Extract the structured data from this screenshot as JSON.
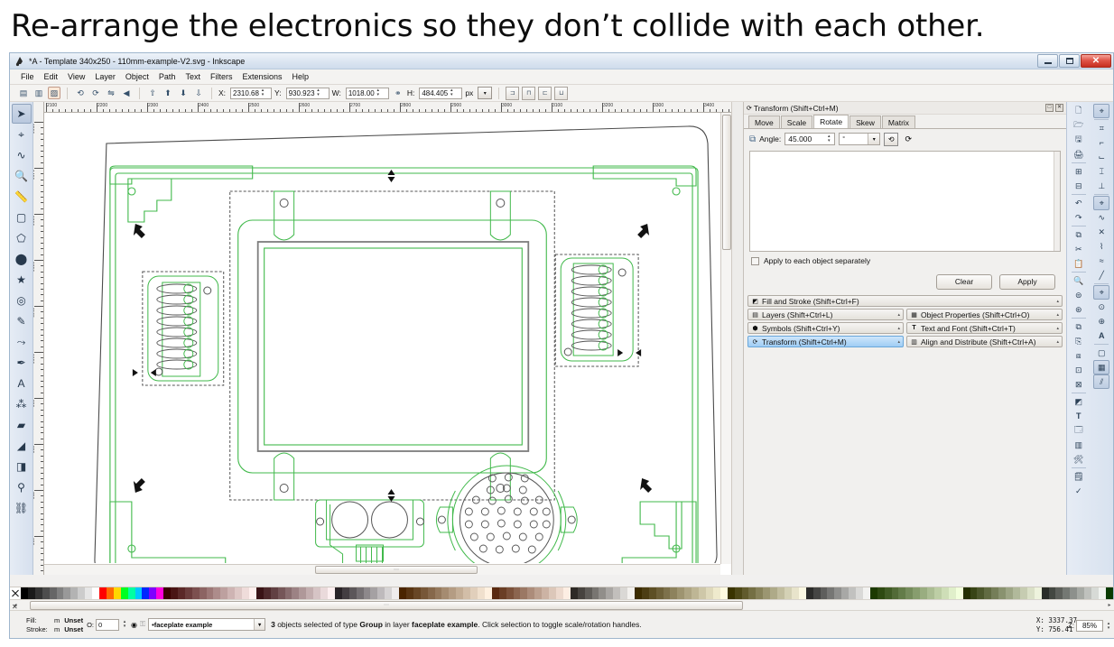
{
  "slide": {
    "heading": "Re-arrange the electronics so they don’t collide with each other."
  },
  "window": {
    "title": "*A - Template 340x250 - 110mm-example-V2.svg - Inkscape",
    "minimize_label": "–",
    "maximize_label": "❐",
    "close_label": "✕"
  },
  "menu": {
    "items": [
      "File",
      "Edit",
      "View",
      "Layer",
      "Object",
      "Path",
      "Text",
      "Filters",
      "Extensions",
      "Help"
    ]
  },
  "toolbar": {
    "icons": [
      "select-all-icon",
      "select-all-layers-icon",
      "deselect-icon",
      "rotate-ccw-icon",
      "rotate-cw-icon",
      "flip-horizontal-icon",
      "flip-vertical-icon",
      "raise-to-top-icon",
      "raise-icon",
      "lower-icon",
      "lower-to-bottom-icon"
    ],
    "x_label": "X:",
    "x_value": "2310.68",
    "y_label": "Y:",
    "y_value": "930.923",
    "w_label": "W:",
    "w_value": "1018.00",
    "lock_label": "⚭",
    "h_label": "H:",
    "h_value": "484.405",
    "units": "px",
    "units_caret": "▾",
    "toggles": [
      "affect-stroke-width",
      "affect-rounded-corners",
      "affect-gradients",
      "affect-patterns"
    ]
  },
  "tools": {
    "items": [
      {
        "name": "selector-tool",
        "glyph": "➤",
        "active": true
      },
      {
        "name": "node-tool",
        "glyph": "✒",
        "active": false
      },
      {
        "name": "tweak-tool",
        "glyph": "∿",
        "active": false
      },
      {
        "name": "zoom-tool",
        "glyph": "⌕",
        "active": false
      },
      {
        "name": "measure-tool",
        "glyph": "╱",
        "active": false
      },
      {
        "name": "rectangle-tool",
        "glyph": "□",
        "active": false
      },
      {
        "name": "3dbox-tool",
        "glyph": "⬡",
        "active": false
      },
      {
        "name": "ellipse-tool",
        "glyph": "●",
        "active": false
      },
      {
        "name": "star-tool",
        "glyph": "★",
        "active": false
      },
      {
        "name": "spiral-tool",
        "glyph": "◎",
        "active": false
      },
      {
        "name": "pencil-tool",
        "glyph": "✎",
        "active": false
      },
      {
        "name": "bezier-tool",
        "glyph": "⤳",
        "active": false
      },
      {
        "name": "calligraphy-tool",
        "glyph": "✒",
        "active": false
      },
      {
        "name": "text-tool",
        "glyph": "A",
        "active": false
      },
      {
        "name": "spray-tool",
        "glyph": "⁂",
        "active": false
      },
      {
        "name": "eraser-tool",
        "glyph": "▰",
        "active": false
      },
      {
        "name": "bucket-fill-tool",
        "glyph": "◢",
        "active": false
      },
      {
        "name": "gradient-tool",
        "glyph": "◧",
        "active": false
      },
      {
        "name": "dropper-tool",
        "glyph": "✒",
        "active": false
      },
      {
        "name": "connector-tool",
        "glyph": "⛓",
        "active": false
      }
    ]
  },
  "rulers": {
    "h_labels": [
      "2100",
      "2200",
      "2300",
      "2400",
      "2500",
      "2600",
      "2700",
      "2800",
      "2900",
      "3000",
      "3100",
      "3200",
      "3300",
      "3400",
      "3500"
    ],
    "v_labels": [
      "1500",
      "1400",
      "1300",
      "1200",
      "1100",
      "1000",
      "900",
      "800",
      "700",
      "600"
    ]
  },
  "transform_dialog": {
    "title": "Transform (Shift+Ctrl+M)",
    "dock_buttons": [
      "□",
      "✕"
    ],
    "tabs": [
      {
        "label": "Move",
        "selected": false
      },
      {
        "label": "Scale",
        "selected": false
      },
      {
        "label": "Rotate",
        "selected": true
      },
      {
        "label": "Skew",
        "selected": false
      },
      {
        "label": "Matrix",
        "selected": false
      }
    ],
    "rotate": {
      "icon": "rotate-icon",
      "angle_label": "Angle:",
      "angle_value": "45.000",
      "unit_value": "°",
      "unit_caret": "▾",
      "direction_ccw": "rotate-counterclockwise-icon",
      "direction_cw": "rotate-clockwise-icon"
    },
    "apply_each_label": "Apply to each object separately",
    "apply_each_checked": false,
    "clear_label": "Clear",
    "apply_label": "Apply"
  },
  "dock_panels": [
    {
      "label": "Fill and Stroke (Shift+Ctrl+F)",
      "icon": "fill-stroke-icon",
      "selected": false,
      "full": true
    },
    {
      "label": "Layers (Shift+Ctrl+L)",
      "icon": "layers-icon",
      "selected": false
    },
    {
      "label": "Object Properties (Shift+Ctrl+O)",
      "icon": "object-properties-icon",
      "selected": false
    },
    {
      "label": "Symbols (Shift+Ctrl+Y)",
      "icon": "symbols-icon",
      "selected": false
    },
    {
      "label": "Text and Font (Shift+Ctrl+T)",
      "icon": "text-font-icon",
      "selected": false
    },
    {
      "label": "Transform (Shift+Ctrl+M)",
      "icon": "transform-icon",
      "selected": true
    },
    {
      "label": "Align and Distribute (Shift+Ctrl+A)",
      "icon": "align-distribute-icon",
      "selected": false
    }
  ],
  "right_icons": {
    "col_a": [
      "new-document-icon",
      "open-icon",
      "save-icon",
      "print-icon",
      "import-icon",
      "export-icon",
      "undo-history-icon",
      "paste-in-place-icon",
      "copy-icon",
      "cut-icon",
      "paste-icon",
      "zoom-selection-icon",
      "zoom-drawing-icon",
      "zoom-page-icon",
      "duplicate-icon",
      "clone-icon",
      "unlink-clone-icon",
      "group-icon",
      "ungroup-icon",
      "fill-stroke-icon",
      "text-font-icon",
      "xml-editor-icon",
      "align-icon",
      "preferences-icon",
      "document-properties-icon",
      "spellcheck-icon",
      "close-icon"
    ],
    "col_b": [
      "pointer-icon",
      "node-icon",
      "ruler-icon",
      "measure-icon",
      "corner-icon",
      "pointer2-icon",
      "curve-icon",
      "diagonal-icon",
      "bezier-icon",
      "line-icon",
      "pointer3-icon",
      "dot-icon",
      "plus-icon",
      "text-a-icon",
      "page-icon",
      "grid-icon",
      "guides-icon"
    ]
  },
  "palette": {
    "none_swatch": "none-color-swatch",
    "scroll_left": "◂",
    "scroll_right": "▸"
  },
  "status": {
    "fill_label": "Fill:",
    "fill_mode": "m",
    "fill_value": "Unset",
    "stroke_label": "Stroke:",
    "stroke_mode": "m",
    "stroke_value": "Unset",
    "opacity_label": "O:",
    "opacity_value": "0",
    "layer_visible_icon": "eye-icon",
    "layer_lock_icon": "unlock-icon",
    "layer_name": "•faceplate example",
    "layer_caret": "▾",
    "message_count": "3",
    "message_a": " objects selected of type ",
    "message_type": "Group",
    "message_b": " in layer ",
    "message_layer": "faceplate example",
    "message_c": ". Click selection to toggle scale/rotation handles.",
    "x_coord": "X: 3337.37",
    "y_coord": "Y:  756.41",
    "zoom_label": "Z:",
    "zoom_value": "85%"
  },
  "colors": {
    "accent_selection": "#9fcdf4",
    "drawing_green": "#41b94b",
    "drawing_gray": "#808080",
    "titlebar_close": "#c72e20"
  }
}
